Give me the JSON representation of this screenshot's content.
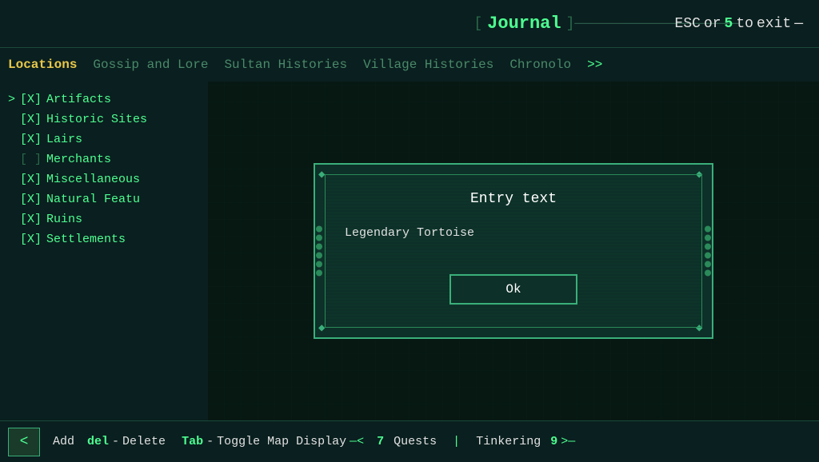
{
  "header": {
    "bracket_open": "[ ",
    "title": "Journal",
    "bracket_close": " ]",
    "line": "———————————",
    "exit_hint": "ESC",
    "exit_or": "or",
    "exit_key": "5",
    "exit_to": "to",
    "exit_label": "exit"
  },
  "tabs": [
    {
      "label": "Locations",
      "active": true
    },
    {
      "label": "Gossip and Lore",
      "active": false
    },
    {
      "label": "Sultan Histories",
      "active": false
    },
    {
      "label": "Village Histories",
      "active": false
    },
    {
      "label": "Chronolo",
      "active": false
    }
  ],
  "tab_arrow": ">>",
  "sidebar": {
    "items": [
      {
        "selected": true,
        "checked": true,
        "label": "Artifacts"
      },
      {
        "selected": false,
        "checked": true,
        "label": "Historic Sites"
      },
      {
        "selected": false,
        "checked": true,
        "label": "Lairs"
      },
      {
        "selected": false,
        "checked": false,
        "label": "Merchants"
      },
      {
        "selected": false,
        "checked": true,
        "label": "Miscellaneous"
      },
      {
        "selected": false,
        "checked": true,
        "label": "Natural Featu"
      },
      {
        "selected": false,
        "checked": true,
        "label": "Ruins"
      },
      {
        "selected": false,
        "checked": true,
        "label": "Settlements"
      }
    ]
  },
  "modal": {
    "title": "Entry text",
    "input_value": "Legendary Tortoise",
    "ok_label": "Ok"
  },
  "bottom_bar": {
    "back_label": "<",
    "hint_add": "Add",
    "hint_del_key": "del",
    "hint_del_dash": "-",
    "hint_del_label": "Delete",
    "hint_tab_key": "Tab",
    "hint_tab_dash": "-",
    "hint_tab_label": "Toggle Map Display",
    "hint_dash": "—<",
    "hint_quests_num": "7",
    "hint_quests_label": "Quests",
    "hint_pipe": "|",
    "hint_tinkering_label": "Tinkering",
    "hint_tinkering_num": "9",
    "hint_end": ">—"
  }
}
